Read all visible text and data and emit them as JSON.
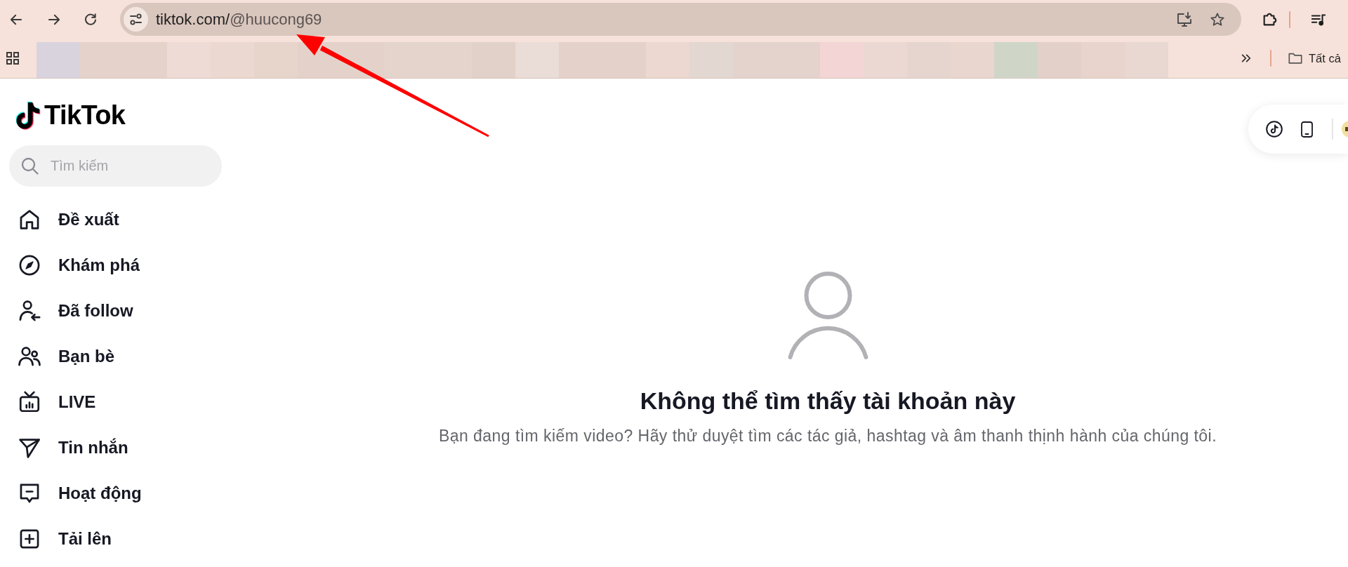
{
  "browser": {
    "address_bar": {
      "host": "tiktok.com/",
      "path": "@huucong69"
    },
    "bookmarks_bar": {
      "folder": "Tất cả"
    }
  },
  "sidebar": {
    "logo": "TikTok",
    "search": {
      "placeholder": "Tìm kiếm"
    },
    "items": [
      {
        "label": "Đề xuất",
        "kind": "home",
        "selected": false
      },
      {
        "label": "Khám phá",
        "kind": "explore",
        "selected": false
      },
      {
        "label": "Đã follow",
        "kind": "following",
        "selected": false
      },
      {
        "label": "Bạn bè",
        "kind": "friends",
        "selected": false
      },
      {
        "label": "LIVE",
        "kind": "live",
        "selected": false
      },
      {
        "label": "Tin nhắn",
        "kind": "messages",
        "selected": false
      },
      {
        "label": "Hoạt động",
        "kind": "activity",
        "selected": false
      },
      {
        "label": "Tải lên",
        "kind": "upload",
        "selected": false
      }
    ]
  },
  "empty_state": {
    "title": "Không thể tìm thấy tài khoản này",
    "message": "Bạn đang tìm kiếm video? Hãy thử duyệt tìm các tác giả, hashtag và âm thanh thịnh hành của chúng tôi."
  },
  "annotations": [
    {
      "kind": "arrow"
    }
  ]
}
